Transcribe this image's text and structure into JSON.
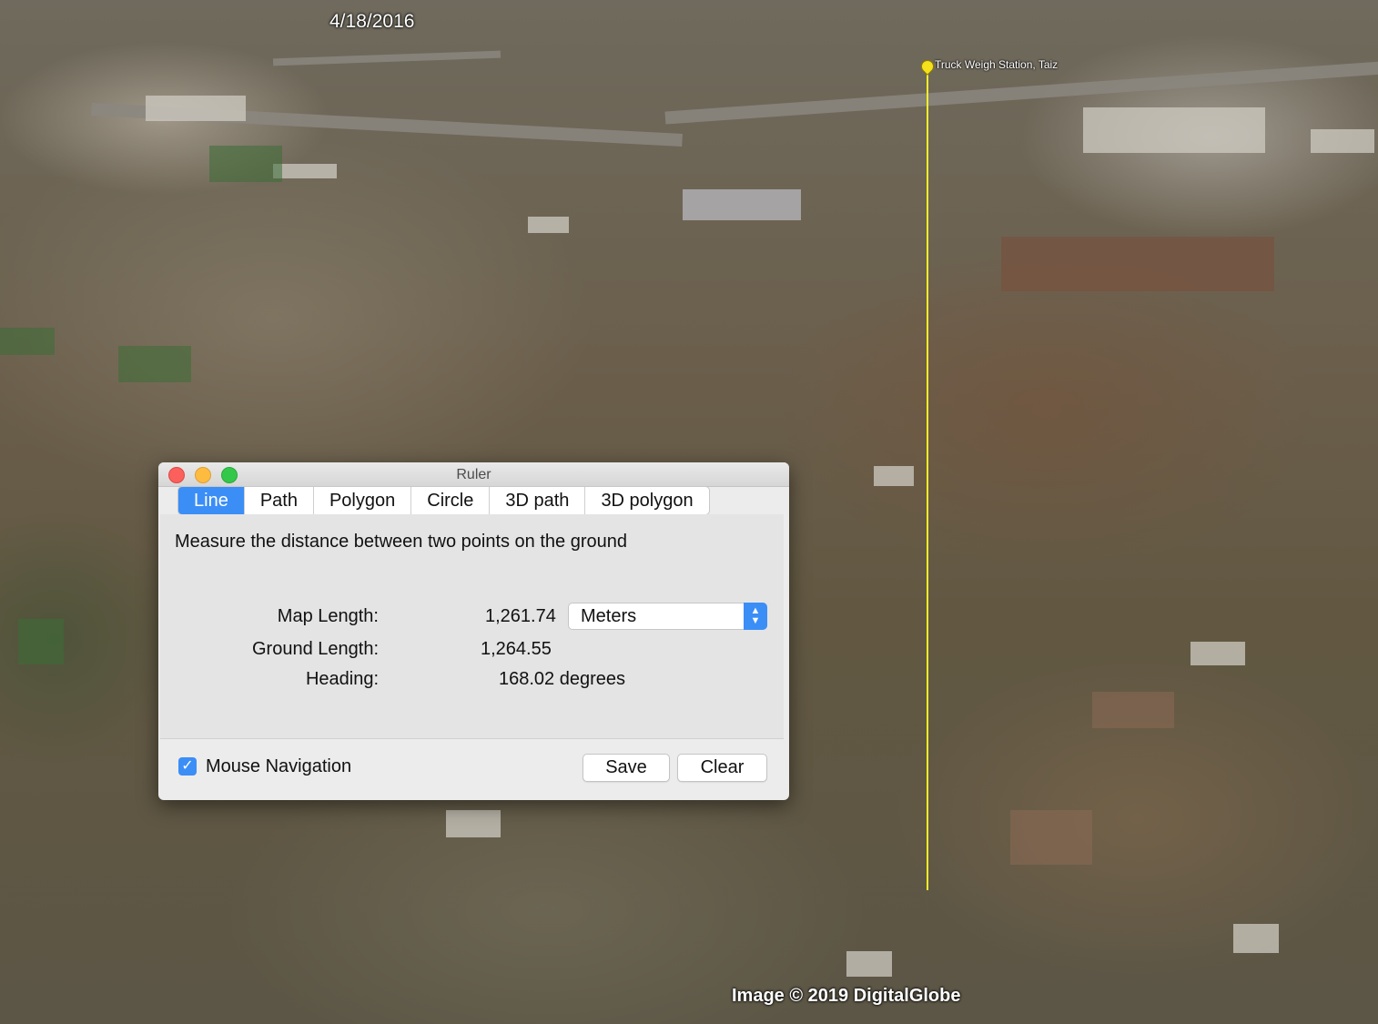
{
  "map": {
    "date": "4/18/2016",
    "placemark_label": "Truck Weigh Station, Taiz",
    "credit": "Image © 2019 DigitalGlobe"
  },
  "ruler": {
    "title": "Ruler",
    "tabs": [
      "Line",
      "Path",
      "Polygon",
      "Circle",
      "3D path",
      "3D polygon"
    ],
    "active_tab": "Line",
    "description": "Measure the distance between two points on the ground",
    "map_length_label": "Map Length:",
    "map_length_value": "1,261.74",
    "unit": "Meters",
    "ground_length_label": "Ground Length:",
    "ground_length_value": "1,264.55",
    "heading_label": "Heading:",
    "heading_value": "168.02 degrees",
    "mouse_navigation_label": "Mouse Navigation",
    "mouse_navigation_checked": true,
    "save_label": "Save",
    "clear_label": "Clear"
  },
  "colors": {
    "accent": "#3b8ef6",
    "measure_line": "#f5ee2a"
  }
}
